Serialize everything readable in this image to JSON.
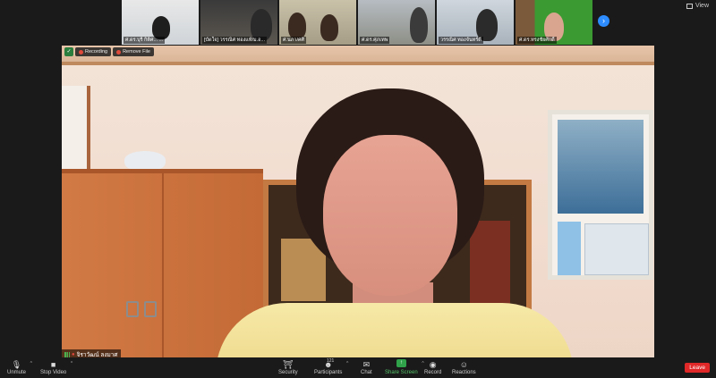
{
  "header": {
    "view_label": "View"
  },
  "thumbnails": [
    {
      "name": "ศ.ดร.บุรี กิติศ... ...",
      "tone": "t1"
    },
    {
      "name": "[บัดใจ] วรรณิศ ทองแท้/ม.อ...",
      "tone": "t2"
    },
    {
      "name": "ศ.นภา/ศศิ",
      "tone": "t3"
    },
    {
      "name": "ศ.ดร.ศุภเทพ",
      "tone": "t4"
    },
    {
      "name": "วรรณิศ ทองจันทร์ดี",
      "tone": "t5"
    },
    {
      "name": "ศ.ดร.ทรงชัยศักดิ์",
      "tone": "t6"
    }
  ],
  "indicators": {
    "recording": "Recording",
    "remote": "Remove File"
  },
  "active_speaker": {
    "name": "จิราวัฒน์ ลงมาศ"
  },
  "toolbar": {
    "unmute": "Unmute",
    "stop_video": "Stop Video",
    "security": "Security",
    "participants": "Participants",
    "participants_count": "121",
    "chat": "Chat",
    "share_screen": "Share Screen",
    "record": "Record",
    "reactions": "Reactions",
    "leave": "Leave"
  },
  "colors": {
    "share": "#2fa24a",
    "leave": "#e02828",
    "accent": "#2d8cff"
  }
}
